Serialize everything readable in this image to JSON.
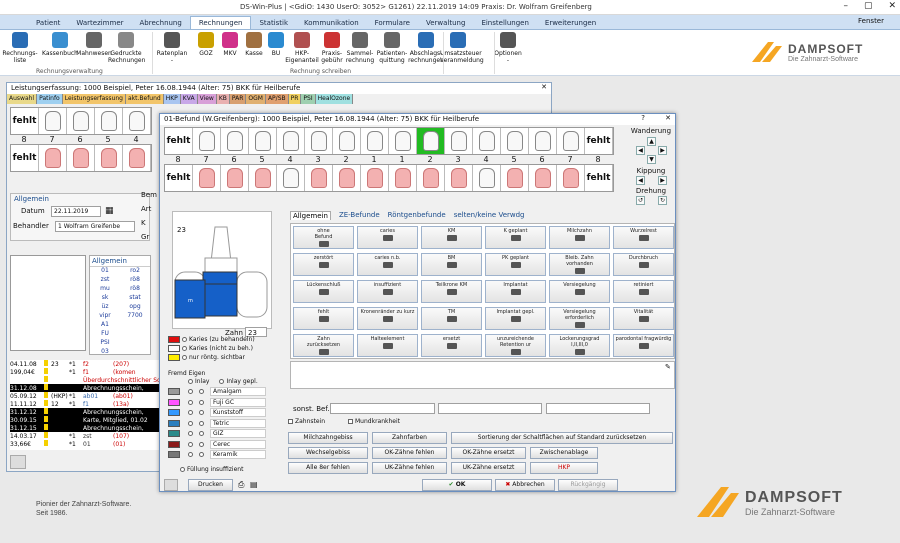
{
  "window": {
    "title": "DS-Win-Plus | <GdiO: 1430 UserO: 3052> G1261) 22.11.2019 14:09 Praxis: Dr. Wolfram Greifenberg",
    "fenster": "Fenster"
  },
  "menu": {
    "tabs": [
      "Patient",
      "Wartezimmer",
      "Abrechnung",
      "Rechnungen",
      "Statistik",
      "Kommunikation",
      "Formulare",
      "Verwaltung",
      "Einstellungen",
      "Erweiterungen"
    ],
    "active": "Rechnungen"
  },
  "ribbon": {
    "items": [
      {
        "label": "Rechnungs-\nliste",
        "icon": "document-list-icon",
        "color": "#2a6db5"
      },
      {
        "label": "Kassenbuch",
        "icon": "book-icon",
        "color": "#3a8fd0"
      },
      {
        "label": "Mahnwesen",
        "icon": "person-icon",
        "color": "#666"
      },
      {
        "label": "Gedruckte\nRechnungen",
        "icon": "printed-invoices-icon",
        "color": "#888"
      },
      {
        "label": "Ratenplan\n-",
        "icon": "person-rate-icon",
        "color": "#555"
      },
      {
        "label": "GOZ",
        "icon": "goz-icon",
        "color": "#c9a000"
      },
      {
        "label": "MKV",
        "icon": "mkv-icon",
        "color": "#d0308a"
      },
      {
        "label": "Kasse",
        "icon": "cash-icon",
        "color": "#a07040"
      },
      {
        "label": "BU",
        "icon": "bu-icon",
        "color": "#2a8ad0"
      },
      {
        "label": "HKP-\nEigenanteil",
        "icon": "hkp-icon",
        "color": "#b05050"
      },
      {
        "label": "Praxis-\ngebühr",
        "icon": "fee-icon",
        "color": "#cc3333"
      },
      {
        "label": "Sammel-\nrechnung",
        "icon": "collective-invoice-icon",
        "color": "#666"
      },
      {
        "label": "Patienten-\nquittung",
        "icon": "receipt-icon",
        "color": "#666"
      },
      {
        "label": "Abschlags-\nrechnungen",
        "icon": "installment-icon",
        "color": "#2a6db5"
      },
      {
        "label": "Umsatzsteuer\nVeranmeldung",
        "icon": "tax-icon",
        "color": "#2a6db5"
      },
      {
        "label": "Optionen\n-",
        "icon": "options-icon",
        "color": "#555"
      }
    ],
    "groups": [
      "Rechnungsverwaltung",
      "Rechnung schreiben"
    ]
  },
  "logo": {
    "name": "DAMPSOFT",
    "tagline": "Die Zahnarzt-Software",
    "claim": "Pionier der Zahnarzt-Software.\nSeit 1986."
  },
  "leistung": {
    "title": "Leistungserfassung: 1000  Beispiel, Peter  16.08.1944 (Alter: 75)  BKK für Heilberufe",
    "tabs": [
      "Auswahl",
      "Patinfo",
      "Leistungserfassung",
      "akt.Befund",
      "HKP",
      "KVA",
      "View",
      "KB",
      "PAR",
      "OGM",
      "AP/SB",
      "PR",
      "PSI",
      "HealOzone"
    ],
    "tab_colors": [
      "#e9d98a",
      "#9fd0f0",
      "#f2c56a",
      "#f2c56a",
      "#a9c5f0",
      "#c8a8e8",
      "#d8a0d8",
      "#e9b0b0",
      "#d8a070",
      "#e0b070",
      "#e0a070",
      "#f0d060",
      "#9fd0b0",
      "#9fe0e0"
    ],
    "upper_numbers": [
      "8",
      "7",
      "6",
      "5",
      "4"
    ],
    "fehlt": "fehlt",
    "allgemein": "Allgemein",
    "datum_label": "Datum",
    "datum": "22.11.2019",
    "behandler_label": "Behandler",
    "behandler": "1 Wolfram Greifenbe",
    "side_labels": [
      "Bem",
      "Art",
      "K",
      "Gr"
    ],
    "codes_header": "Allgemein",
    "codes": [
      [
        "01",
        "ro2"
      ],
      [
        "zst",
        "rö8"
      ],
      [
        "mu",
        "rö8"
      ],
      [
        "sk",
        "stat"
      ],
      [
        "üz",
        "opg"
      ],
      [
        "vipr",
        "7700"
      ],
      [
        "A1",
        ""
      ],
      [
        "FU",
        ""
      ],
      [
        "PSI",
        ""
      ],
      [
        "03",
        ""
      ]
    ],
    "history": [
      {
        "date": "04.11.08",
        "a": "23",
        "b": "*1",
        "code": "f2",
        "val": "(207)",
        "color": "#000",
        "codecolor": "#c00",
        "bg": "#fff"
      },
      {
        "date": "199,04€",
        "a": "",
        "b": "*1",
        "code": "f1",
        "val": "(komen",
        "color": "#000",
        "codecolor": "#c00",
        "bg": "#fff"
      },
      {
        "date": "",
        "a": "",
        "b": "",
        "code": "Überdurchschnittlicher Schwiengk",
        "val": "",
        "color": "#c00",
        "codecolor": "#c00",
        "bg": "#fff"
      },
      {
        "date": "31.12.08",
        "a": "",
        "b": "",
        "code": "Abrechnungsschein,",
        "val": "",
        "color": "#fff",
        "codecolor": "#fff",
        "bg": "#000"
      },
      {
        "date": "05.09.12",
        "a": "(HKP)",
        "b": "*1",
        "code": "ab01",
        "val": "(ab01)",
        "color": "#000",
        "codecolor": "#3366aa",
        "bg": "#fff"
      },
      {
        "date": "11.11.12",
        "a": "12",
        "b": "*1",
        "code": "f1",
        "val": "(13a)",
        "color": "#000",
        "codecolor": "#3366aa",
        "bg": "#fff"
      },
      {
        "date": "31.12.12",
        "a": "",
        "b": "",
        "code": "Abrechnungsschein,",
        "val": "",
        "color": "#fff",
        "codecolor": "#fff",
        "bg": "#000"
      },
      {
        "date": "30.09.15",
        "a": "",
        "b": "",
        "code": "Karte, Mitglied, 01.02",
        "val": "",
        "color": "#fff",
        "codecolor": "#fff",
        "bg": "#000"
      },
      {
        "date": "31.12.15",
        "a": "",
        "b": "",
        "code": "Abrechnungsschein,",
        "val": "",
        "color": "#fff",
        "codecolor": "#fff",
        "bg": "#000"
      },
      {
        "date": "14.03.17",
        "a": "",
        "b": "*1",
        "code": "zst",
        "val": "(107)",
        "color": "#000",
        "codecolor": "#333",
        "bg": "#fff"
      },
      {
        "date": "33,66€",
        "a": "",
        "b": "*1",
        "code": "01",
        "val": "(01)",
        "color": "#000",
        "codecolor": "#333",
        "bg": "#fff"
      }
    ]
  },
  "befund": {
    "title": "01-Befund (W.Greifenberg): 1000  Beispiel, Peter  16.08.1944 (Alter: 75)  BKK für Heilberufe",
    "help": "?",
    "fehlt": "fehlt",
    "upper_numbers": [
      "7",
      "6",
      "5",
      "4",
      "3",
      "2",
      "1",
      "1",
      "2",
      "3",
      "4",
      "5",
      "6",
      "7"
    ],
    "lower_numbers": [
      "7",
      "6",
      "5",
      "4",
      "3",
      "2",
      "1",
      "1",
      "2",
      "3",
      "4",
      "5",
      "6",
      "7"
    ],
    "edge_numbers": [
      "8",
      "8"
    ],
    "wanderung": "Wanderung",
    "kippung": "Kippung",
    "drehung": "Drehung",
    "tooth_number": "23",
    "zahn_label": "Zahn",
    "zahn_value": "23",
    "legend": [
      {
        "color": "#e01010",
        "label": "Karies (zu behandeln)",
        "radio": true
      },
      {
        "color": "#ffffff",
        "label": "Karies (nicht zu beh.)",
        "radio": true
      },
      {
        "color": "#ffee00",
        "label": "nur röntg. sichtbar",
        "radio": true
      }
    ],
    "fremd_label": "Fremd Eigen",
    "inlay": "Inlay",
    "inlay_gepl": "Inlay gepl.",
    "materials": [
      {
        "color": "#9a9a9a",
        "label": "Amalgam"
      },
      {
        "color": "#ff55ff",
        "label": "Fuji GC"
      },
      {
        "color": "#3399ff",
        "label": "Kunststoff"
      },
      {
        "color": "#2b7fbf",
        "label": "Tetric"
      },
      {
        "color": "#2b8a8a",
        "label": "GIZ"
      },
      {
        "color": "#8b1a1a",
        "label": "Cerec"
      },
      {
        "color": "#777777",
        "label": "Keramik"
      }
    ],
    "fuellung_insuff": "Füllung insuffizient",
    "tabs": [
      "Allgemein",
      "ZE-Befunde",
      "Röntgenbefunde",
      "selten/keine Verwdg"
    ],
    "buttons": [
      [
        "ohne\nBefund",
        "caries",
        "KM",
        "K geplant",
        "Milchzahn",
        "Wurzelrest"
      ],
      [
        "zerstört",
        "caries n.b.",
        "BM",
        "PK geplant",
        "Bleib. Zahn\nvorhanden",
        "Durchbruch"
      ],
      [
        "Lückenschluß",
        "insuffizient",
        "Teilkrone KM",
        "Implantat",
        "Versiegelung",
        "retiniert"
      ],
      [
        "fehlt",
        "Kronenränder zu kurz",
        "TM",
        "Implantat gepl.",
        "Versiegelung\nerforderlich",
        "Vitalität"
      ],
      [
        "Zahn\nzurücksetzen",
        "Halteelement",
        "ersetzt",
        "unzureichende\nRetention ur",
        "Lockerungsgrad\nI,II,III,0",
        "parodontal fragwürdig"
      ]
    ],
    "sonst_bef": "sonst. Bef.",
    "zahnstein": "Zahnstein",
    "mundkrankheit": "Mundkrankheit",
    "action_rows": [
      [
        "Milchzahngebiss",
        "Zahnfarben",
        "Sortierung der Schaltflächen auf Standard zurücksetzen"
      ],
      [
        "Wechselgebiss",
        "OK-Zähne fehlen",
        "OK-Zähne ersetzt",
        "Zwischenablage"
      ],
      [
        "Alle 8er fehlen",
        "UK-Zähne fehlen",
        "UK-Zähne ersetzt",
        "HKP"
      ]
    ],
    "drucken": "Drucken",
    "ok": "OK",
    "abbrechen": "Abbrechen",
    "rueckgaengig": "Rückgängig"
  }
}
